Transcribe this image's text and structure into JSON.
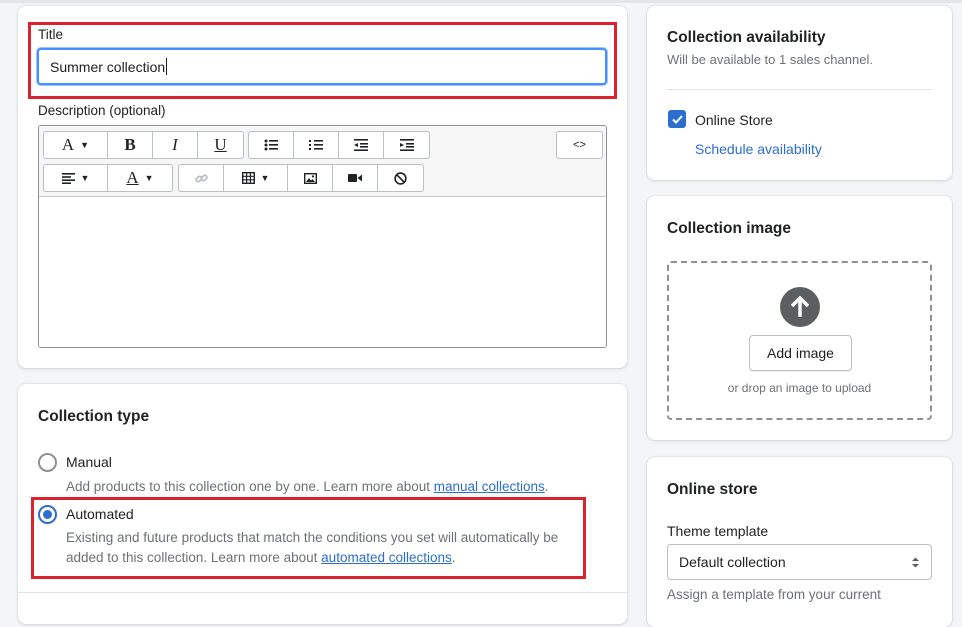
{
  "title_section": {
    "label": "Title",
    "value": "Summer collection"
  },
  "description": {
    "label": "Description (optional)",
    "toolbar": {
      "font": "A",
      "bold": "B",
      "italic": "I",
      "underline": "U",
      "text_color": "A",
      "html_toggle": "<>",
      "dropdown_arrow": "▼"
    },
    "icons": [
      "font-format-icon",
      "bold-icon",
      "italic-icon",
      "underline-icon",
      "bulleted-list-icon",
      "numbered-list-icon",
      "outdent-icon",
      "indent-icon",
      "show-html-icon",
      "align-icon",
      "text-color-icon",
      "link-icon",
      "table-icon",
      "image-icon",
      "video-icon",
      "clear-format-icon"
    ]
  },
  "collection_type": {
    "heading": "Collection type",
    "manual": {
      "label": "Manual",
      "help": "Add products to this collection one by one. Learn more about ",
      "link": "manual collections",
      "period": "."
    },
    "automated": {
      "label": "Automated",
      "selected": true,
      "help_line1": "Existing and future products that match the conditions you set will automatically be",
      "help_line2": "added to this collection. Learn more about ",
      "link": "automated collections",
      "period": "."
    }
  },
  "availability": {
    "heading": "Collection availability",
    "subtitle": "Will be available to 1 sales channel.",
    "channel": "Online Store",
    "channel_checked": true,
    "schedule_link": "Schedule availability"
  },
  "collection_image": {
    "heading": "Collection image",
    "button": "Add image",
    "hint": "or drop an image to upload"
  },
  "online_store": {
    "heading": "Online store",
    "theme_label": "Theme template",
    "theme_value": "Default collection",
    "help": "Assign a template from your current"
  },
  "colors": {
    "accent": "#2c6ecb",
    "highlight": "#d9232f",
    "focus": "#458fff"
  }
}
